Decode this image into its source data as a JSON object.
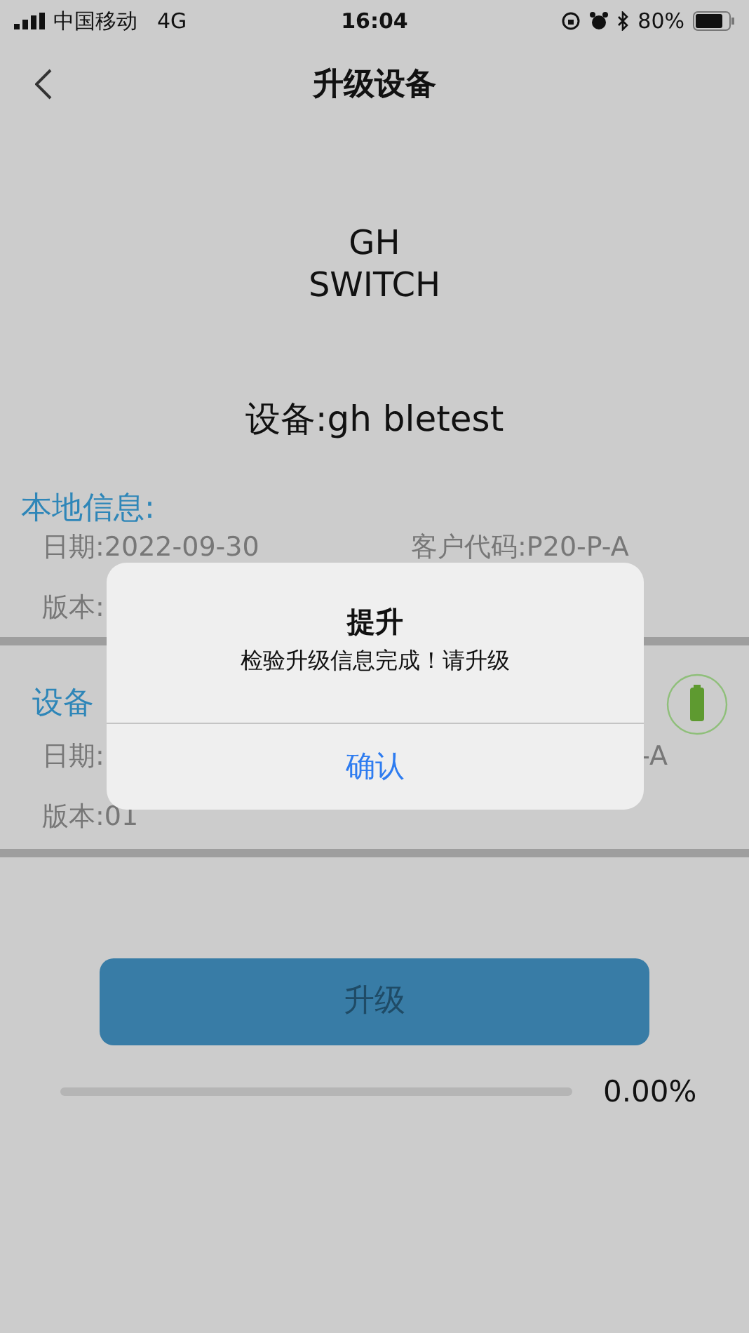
{
  "status_bar": {
    "carrier": "中国移动",
    "network": "4G",
    "time": "16:04",
    "battery": "80%"
  },
  "nav": {
    "title": "升级设备"
  },
  "product": {
    "lines": [
      "GH",
      "SWITCH"
    ]
  },
  "device_name": "设备:gh bletest",
  "local_info": {
    "heading": "本地信息:",
    "date": "日期:2022-09-30",
    "customer_code": "客户代码:P20-P-A",
    "version": "版本:"
  },
  "device_info": {
    "heading": "设备",
    "date": "日期:",
    "customer_code": "-A",
    "version": "版本:01"
  },
  "upgrade_button": {
    "label": "升级",
    "disabled": true
  },
  "progress": {
    "level": 0,
    "reading": "0.00%"
  },
  "dialog": {
    "title": "提升",
    "message": "检验升级信息完成！请升级",
    "button": "确认"
  }
}
